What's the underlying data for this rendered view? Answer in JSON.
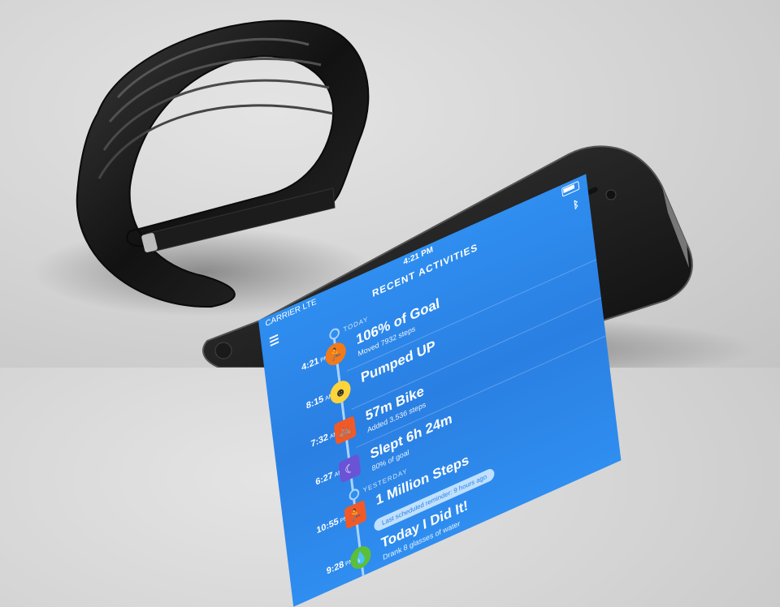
{
  "status": {
    "carrier": "CARRIER LTE",
    "time": "4:21 PM"
  },
  "header": {
    "title": "RECENT ACTIVITIES",
    "menu_icon": "menu-icon",
    "bt_icon": "bluetooth-icon"
  },
  "days": {
    "today": "TODAY",
    "yesterday": "YESTERDAY"
  },
  "activities": [
    {
      "time": "4:21",
      "ampm": "PM",
      "title": "106% of Goal",
      "sub": "Moved 7932 steps",
      "icon": "running-icon",
      "color": "#f27a1a"
    },
    {
      "time": "8:15",
      "ampm": "AM",
      "title": "Pumped UP",
      "sub": "",
      "icon": "smiley-icon",
      "color": "#ffd43a"
    },
    {
      "time": "7:32",
      "ampm": "AM",
      "title": "57m Bike",
      "sub": "Added 3,536 steps",
      "icon": "bike-icon",
      "color": "#f05a28"
    },
    {
      "time": "6:27",
      "ampm": "AM",
      "title": "Slept 6h 24m",
      "sub": "80% of goal",
      "icon": "moon-icon",
      "color": "#6b53d6"
    },
    {
      "time": "10:55",
      "ampm": "PM",
      "title": "1 Million Steps",
      "sub": "",
      "icon": "runner-badge-icon",
      "color": "#f05a28"
    },
    {
      "time": "9:28",
      "ampm": "PM",
      "title": "Today I Did It!",
      "sub": "Drank 8 glasses of water",
      "icon": "drop-icon",
      "color": "#5bbf3a"
    }
  ],
  "pill": "Last scheduled reminder: 9 hours ago",
  "colors": {
    "screen": "#2f8ef0",
    "band": "#1a1a1a",
    "phone": "#222222"
  }
}
